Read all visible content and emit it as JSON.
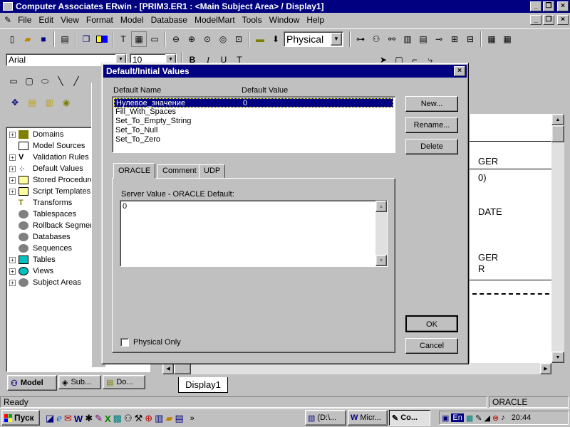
{
  "app": {
    "title": "Computer Associates ERwin - [PRIM3.ER1 : <Main Subject Area> / Display1]",
    "title_icon": "erwin-icon"
  },
  "menu": [
    "File",
    "Edit",
    "View",
    "Format",
    "Model",
    "Database",
    "ModelMart",
    "Tools",
    "Window",
    "Help"
  ],
  "toolbar": {
    "physical_select": "Physical",
    "font_name": "Arial",
    "font_size": "10"
  },
  "tree": {
    "items": [
      {
        "label": "Domains",
        "icon": "domain-icon"
      },
      {
        "label": "Model Sources",
        "icon": "model-source-icon"
      },
      {
        "label": "Validation Rules",
        "icon": "validation-icon"
      },
      {
        "label": "Default Values",
        "icon": "default-values-icon"
      },
      {
        "label": "Stored Procedures",
        "icon": "stored-proc-icon"
      },
      {
        "label": "Script Templates",
        "icon": "script-icon"
      },
      {
        "label": "Transforms",
        "icon": "transform-icon"
      },
      {
        "label": "Tablespaces",
        "icon": "tablespace-icon"
      },
      {
        "label": "Rollback Segments",
        "icon": "rollback-icon"
      },
      {
        "label": "Databases",
        "icon": "database-icon"
      },
      {
        "label": "Sequences",
        "icon": "sequence-icon"
      },
      {
        "label": "Tables",
        "icon": "table-icon"
      },
      {
        "label": "Views",
        "icon": "view-icon"
      },
      {
        "label": "Subject Areas",
        "icon": "subject-area-icon"
      }
    ],
    "tabs": [
      "Model",
      "Sub...",
      "Do..."
    ]
  },
  "diagram": {
    "fragments": [
      "GER",
      "0)",
      "DATE",
      "GER",
      "R"
    ],
    "tab": "Display1"
  },
  "dialog": {
    "title": "Default/Initial Values",
    "col_name": "Default Name",
    "col_value": "Default Value",
    "rows": [
      {
        "name": "Нулевое_значение",
        "value": "0"
      },
      {
        "name": "Fill_With_Spaces",
        "value": ""
      },
      {
        "name": "Set_To_Empty_String",
        "value": ""
      },
      {
        "name": "Set_To_Null",
        "value": ""
      },
      {
        "name": "Set_To_Zero",
        "value": ""
      }
    ],
    "buttons": {
      "new": "New...",
      "rename": "Rename...",
      "delete": "Delete",
      "ok": "OK",
      "cancel": "Cancel"
    },
    "tabs": [
      "ORACLE",
      "Comment",
      "UDP"
    ],
    "server_label": "Server Value - ORACLE Default:",
    "server_value": "0",
    "physical_only": "Physical Only"
  },
  "status": {
    "left": "Ready",
    "right": "ORACLE"
  },
  "taskbar": {
    "start": "Пуск",
    "tasks": [
      "(D:\\...",
      "Micr...",
      "Co..."
    ],
    "tray_lang": "En",
    "clock": "20:44"
  },
  "colors": {
    "title_bar": "#000080",
    "selection": "#000080",
    "desktop_gray": "#c0c0c0"
  }
}
